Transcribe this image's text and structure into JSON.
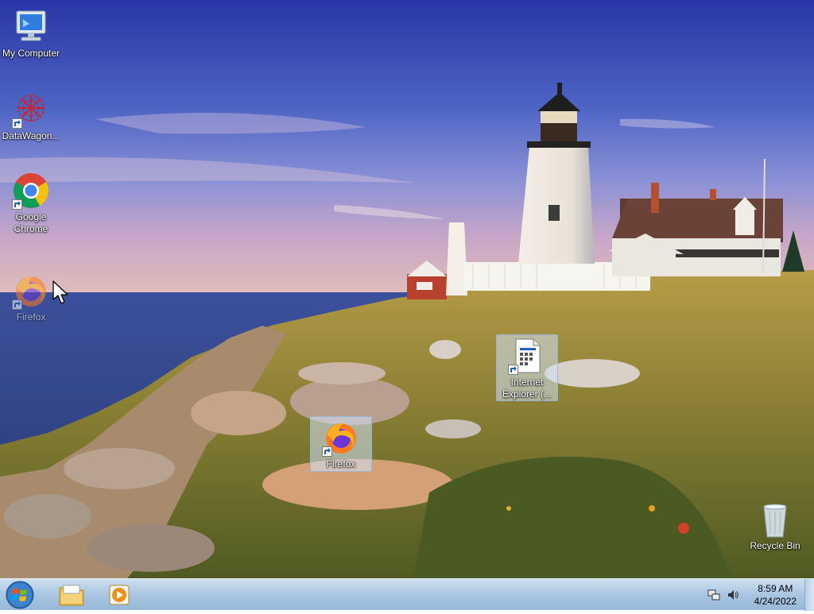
{
  "desktop": {
    "icons": [
      {
        "label": "My Computer",
        "icon": "my-computer-icon"
      },
      {
        "label": "DataWagon...",
        "icon": "datawagon-icon"
      },
      {
        "label": "Google Chrome",
        "icon": "chrome-icon"
      },
      {
        "label": "Firefox",
        "icon": "firefox-icon"
      },
      {
        "label": "Internet Explorer (...",
        "icon": "internet-explorer-icon"
      },
      {
        "label": "Firefox",
        "icon": "firefox-icon"
      },
      {
        "label": "Recycle Bin",
        "icon": "recycle-bin-icon"
      }
    ]
  },
  "taskbar": {
    "start": "start-button-icon",
    "pinned": [
      "file-explorer-icon",
      "media-player-icon"
    ],
    "tray_icons": [
      "network-icon",
      "volume-icon"
    ],
    "clock_time": "8:59 AM",
    "clock_date": "4/24/2022"
  },
  "colors": {
    "taskbar": "#a9c6e2",
    "sky_top": "#2f3fa8",
    "sea": "#3a4f9a"
  }
}
